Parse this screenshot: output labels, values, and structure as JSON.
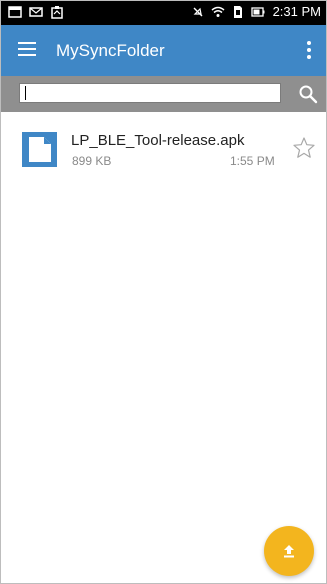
{
  "status_bar": {
    "time": "2:31 PM",
    "icons": [
      "notification-icon",
      "mail-icon",
      "clipboard-icon",
      "mute-icon",
      "wifi-icon",
      "sd-card-icon",
      "battery-icon"
    ]
  },
  "app_bar": {
    "title": "MySyncFolder",
    "color": "#3f87c6"
  },
  "search": {
    "value": "",
    "placeholder": ""
  },
  "files": [
    {
      "name": "LP_BLE_Tool-release.apk",
      "size": "899 KB",
      "time": "1:55 PM",
      "starred": false
    }
  ],
  "fab": {
    "icon": "upload-icon",
    "color": "#f3b51e"
  }
}
